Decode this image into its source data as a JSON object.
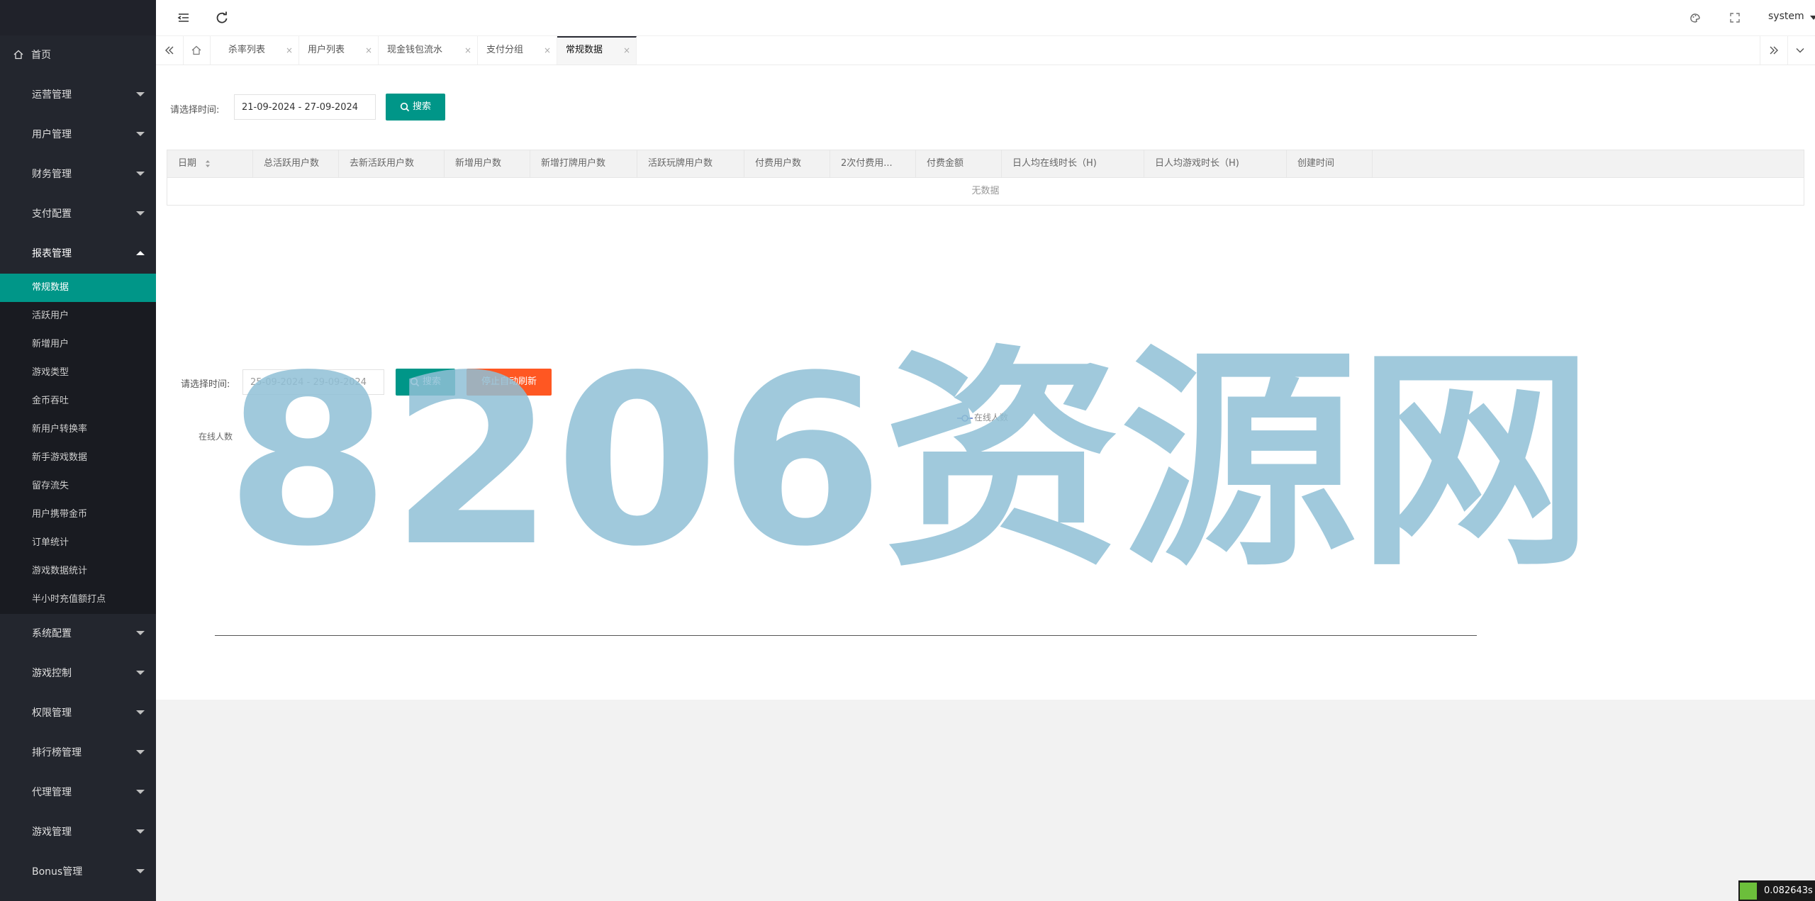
{
  "sidebar": {
    "home": "首页",
    "menus_top": [
      "运营管理",
      "用户管理",
      "财务管理",
      "支付配置"
    ],
    "report_menu": "报表管理",
    "report_items": [
      "常规数据",
      "活跃用户",
      "新增用户",
      "游戏类型",
      "金币吞吐",
      "新用户转换率",
      "新手游戏数据",
      "留存流失",
      "用户携带金币",
      "订单统计",
      "游戏数据统计",
      "半小时充值额打点"
    ],
    "active_item": "常规数据",
    "menus_bottom": [
      "系统配置",
      "游戏控制",
      "权限管理",
      "排行榜管理",
      "代理管理",
      "游戏管理",
      "Bonus管理"
    ]
  },
  "header": {
    "user": "system"
  },
  "tabs": {
    "items": [
      "杀率列表",
      "用户列表",
      "现金钱包流水",
      "支付分组",
      "常规数据"
    ],
    "active": "常规数据",
    "close_glyph": "×"
  },
  "filter1": {
    "label": "请选择时间:",
    "date_range": "21-09-2024 - 27-09-2024",
    "search_label": "搜索"
  },
  "table": {
    "columns": [
      "日期",
      "总活跃用户数",
      "去新活跃用户数",
      "新增用户数",
      "新增打牌用户数",
      "活跃玩牌用户数",
      "付费用户数",
      "2次付费用...",
      "付费金额",
      "日人均在线时长（H)",
      "日人均游戏时长（H)",
      "创建时间"
    ],
    "empty_text": "无数据"
  },
  "filter2": {
    "label": "请选择时间:",
    "date_range": "25-09-2024 - 29-09-2024",
    "search_label": "搜索",
    "stop_refresh_label": "停止自动刷新"
  },
  "chart": {
    "y_label": "在线人数",
    "legend": "在线人数"
  },
  "watermark": {
    "text": "8206资源网"
  },
  "perf": {
    "value": "0.082643s"
  },
  "colors": {
    "sidebar_bg": "#23262e",
    "accent": "#009688",
    "orange": "#ff5722",
    "watermark": "#8fbfd6"
  }
}
